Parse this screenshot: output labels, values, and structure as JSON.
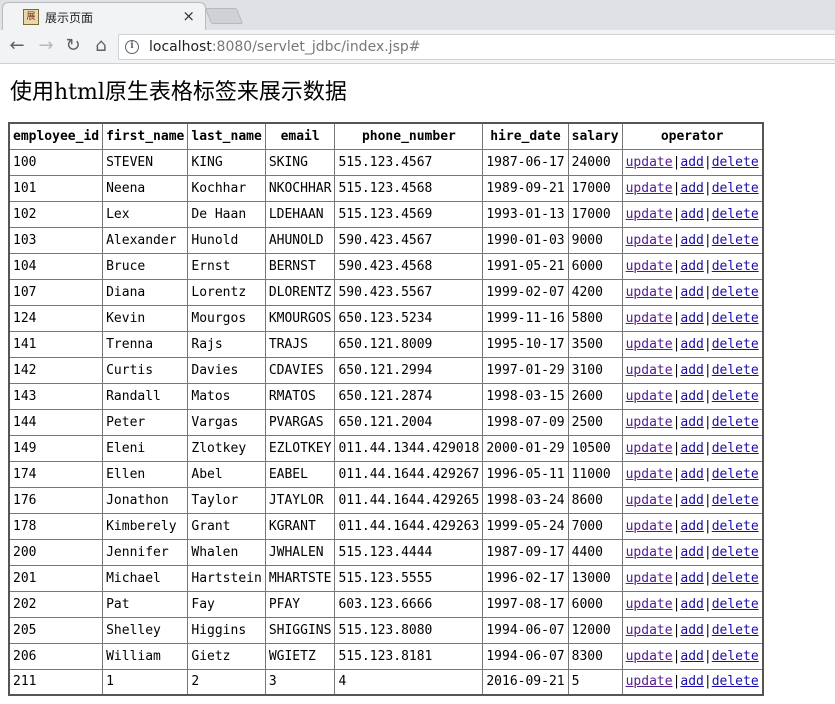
{
  "browser": {
    "tab_title": "展示页面",
    "tab_favicon_glyph": "展",
    "close_glyph": "×",
    "back_glyph": "←",
    "forward_glyph": "→",
    "reload_glyph": "↻",
    "home_glyph": "⌂",
    "info_glyph": "i",
    "url_host": "localhost",
    "url_path": ":8080/servlet_jdbc/index.jsp#"
  },
  "page": {
    "title": "使用html原生表格标签来展示数据"
  },
  "table": {
    "headers": [
      "employee_id",
      "first_name",
      "last_name",
      "email",
      "phone_number",
      "hire_date",
      "salary",
      "operator"
    ],
    "actions": {
      "update": "update",
      "add": "add",
      "delete": "delete",
      "separator": "|"
    },
    "rows": [
      [
        "100",
        "STEVEN",
        "KING",
        "SKING",
        "515.123.4567",
        "1987-06-17",
        "24000"
      ],
      [
        "101",
        "Neena",
        "Kochhar",
        "NKOCHHAR",
        "515.123.4568",
        "1989-09-21",
        "17000"
      ],
      [
        "102",
        "Lex",
        "De Haan",
        "LDEHAAN",
        "515.123.4569",
        "1993-01-13",
        "17000"
      ],
      [
        "103",
        "Alexander",
        "Hunold",
        "AHUNOLD",
        "590.423.4567",
        "1990-01-03",
        "9000"
      ],
      [
        "104",
        "Bruce",
        "Ernst",
        "BERNST",
        "590.423.4568",
        "1991-05-21",
        "6000"
      ],
      [
        "107",
        "Diana",
        "Lorentz",
        "DLORENTZ",
        "590.423.5567",
        "1999-02-07",
        "4200"
      ],
      [
        "124",
        "Kevin",
        "Mourgos",
        "KMOURGOS",
        "650.123.5234",
        "1999-11-16",
        "5800"
      ],
      [
        "141",
        "Trenna",
        "Rajs",
        "TRAJS",
        "650.121.8009",
        "1995-10-17",
        "3500"
      ],
      [
        "142",
        "Curtis",
        "Davies",
        "CDAVIES",
        "650.121.2994",
        "1997-01-29",
        "3100"
      ],
      [
        "143",
        "Randall",
        "Matos",
        "RMATOS",
        "650.121.2874",
        "1998-03-15",
        "2600"
      ],
      [
        "144",
        "Peter",
        "Vargas",
        "PVARGAS",
        "650.121.2004",
        "1998-07-09",
        "2500"
      ],
      [
        "149",
        "Eleni",
        "Zlotkey",
        "EZLOTKEY",
        "011.44.1344.429018",
        "2000-01-29",
        "10500"
      ],
      [
        "174",
        "Ellen",
        "Abel",
        "EABEL",
        "011.44.1644.429267",
        "1996-05-11",
        "11000"
      ],
      [
        "176",
        "Jonathon",
        "Taylor",
        "JTAYLOR",
        "011.44.1644.429265",
        "1998-03-24",
        "8600"
      ],
      [
        "178",
        "Kimberely",
        "Grant",
        "KGRANT",
        "011.44.1644.429263",
        "1999-05-24",
        "7000"
      ],
      [
        "200",
        "Jennifer",
        "Whalen",
        "JWHALEN",
        "515.123.4444",
        "1987-09-17",
        "4400"
      ],
      [
        "201",
        "Michael",
        "Hartstein",
        "MHARTSTE",
        "515.123.5555",
        "1996-02-17",
        "13000"
      ],
      [
        "202",
        "Pat",
        "Fay",
        "PFAY",
        "603.123.6666",
        "1997-08-17",
        "6000"
      ],
      [
        "205",
        "Shelley",
        "Higgins",
        "SHIGGINS",
        "515.123.8080",
        "1994-06-07",
        "12000"
      ],
      [
        "206",
        "William",
        "Gietz",
        "WGIETZ",
        "515.123.8181",
        "1994-06-07",
        "8300"
      ],
      [
        "211",
        "1",
        "2",
        "3",
        "4",
        "2016-09-21",
        "5"
      ]
    ]
  }
}
